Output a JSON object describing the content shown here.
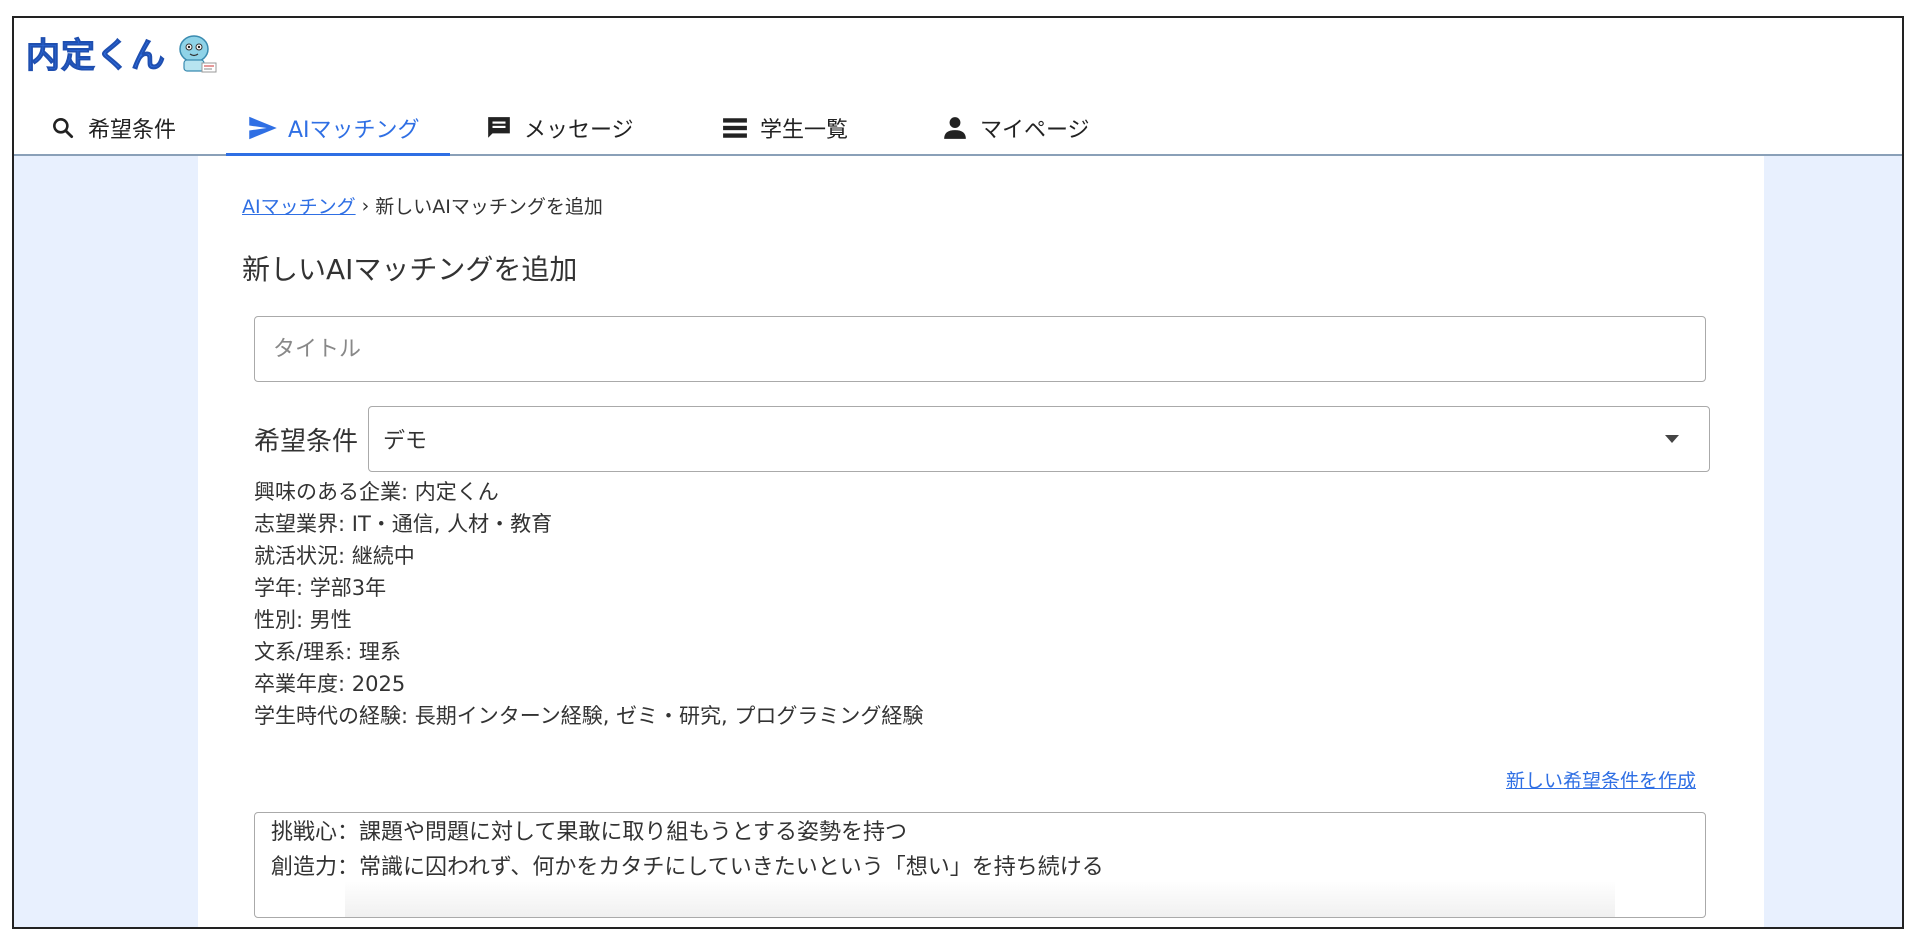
{
  "app": {
    "logo_text": "内定くん"
  },
  "nav": {
    "items": [
      {
        "label": "希望条件",
        "icon": "search-icon"
      },
      {
        "label": "AIマッチング",
        "icon": "send-icon",
        "active": true
      },
      {
        "label": "メッセージ",
        "icon": "message-icon"
      },
      {
        "label": "学生一覧",
        "icon": "list-icon"
      },
      {
        "label": "マイページ",
        "icon": "person-icon"
      }
    ]
  },
  "breadcrumb": {
    "parent": "AIマッチング",
    "separator": "›",
    "current": "新しいAIマッチングを追加"
  },
  "page": {
    "title": "新しいAIマッチングを追加"
  },
  "form": {
    "title_placeholder": "タイトル",
    "condition_label": "希望条件",
    "condition_value": "デモ",
    "details": [
      "興味のある企業: 内定くん",
      "志望業界: IT・通信, 人材・教育",
      "就活状況: 継続中",
      "学年: 学部3年",
      "性別: 男性",
      "文系/理系: 理系",
      "卒業年度: 2025",
      "学生時代の経験: 長期インターン経験, ゼミ・研究, プログラミング経験"
    ],
    "new_condition_link": "新しい希望条件を作成",
    "textarea_lines": [
      "挑戦心：課題や問題に対して果敢に取り組もうとする姿勢を持つ",
      "創造力：常識に囚われず、何かをカタチにしていきたいという「想い」を持ち続ける"
    ]
  },
  "colors": {
    "accent": "#2f6fe4",
    "page_bg": "#e8f0fe"
  }
}
